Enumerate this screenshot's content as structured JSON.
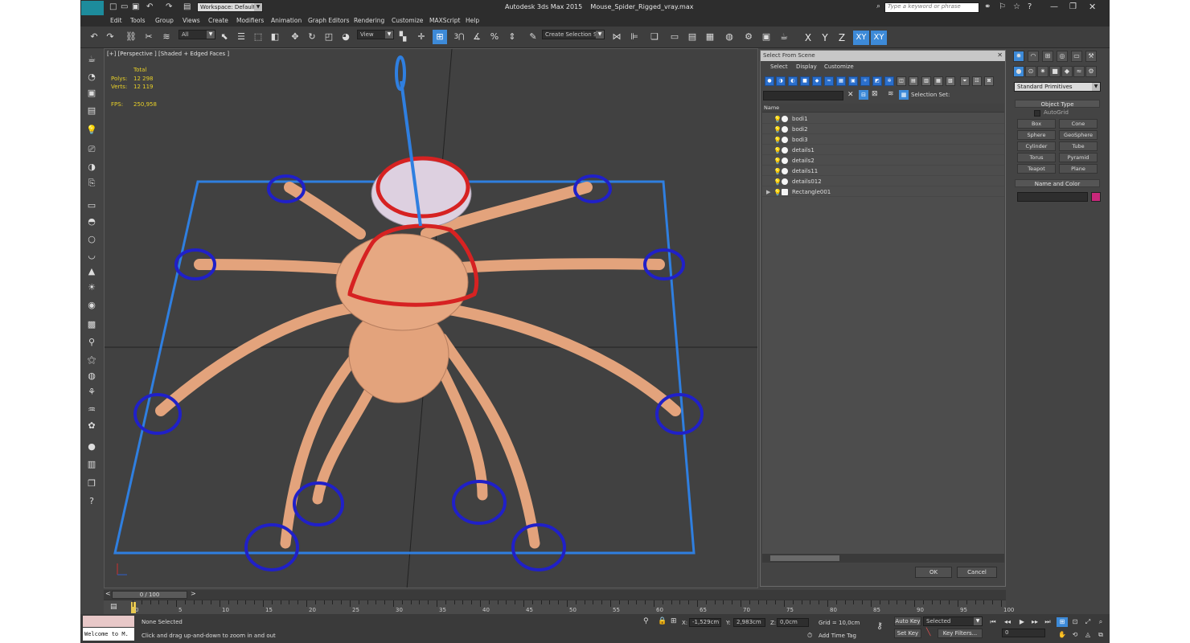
{
  "title": {
    "app": "Autodesk 3ds Max  2015",
    "file": "Mouse_Spider_Rigged_vray.max",
    "logo": "MAX",
    "workspace": "Workspace: Default",
    "search_placeholder": "Type a keyword or phrase"
  },
  "menu": [
    "Edit",
    "Tools",
    "Group",
    "Views",
    "Create",
    "Modifiers",
    "Animation",
    "Graph Editors",
    "Rendering",
    "Customize",
    "MAXScript",
    "Help"
  ],
  "toolbar": {
    "filter": "All",
    "coord": "View",
    "selection_set": "Create Selection Se",
    "snap_label": "3",
    "axes": [
      "X",
      "Y",
      "Z",
      "XY",
      "XY"
    ]
  },
  "viewport": {
    "label": "[+] [Perspective ] [Shaded + Edged Faces ]",
    "stats": {
      "total_label": "Total",
      "polys_label": "Polys:",
      "polys": "12 298",
      "verts_label": "Verts:",
      "verts": "12 119",
      "fps_label": "FPS:",
      "fps": "250,958"
    }
  },
  "scene_dialog": {
    "title": "Select From Scene",
    "menus": [
      "Select",
      "Display",
      "Customize"
    ],
    "selection_set_label": "Selection Set:",
    "column_name": "Name",
    "items": [
      "bodi1",
      "bodi2",
      "bodi3",
      "details1",
      "details2",
      "details11",
      "details012",
      "Rectangle001"
    ],
    "ok": "OK",
    "cancel": "Cancel"
  },
  "command_panel": {
    "category": "Standard Primitives",
    "object_type_title": "Object Type",
    "autogrid": "AutoGrid",
    "primitives": [
      "Box",
      "Cone",
      "Sphere",
      "GeoSphere",
      "Cylinder",
      "Tube",
      "Torus",
      "Pyramid",
      "Teapot",
      "Plane"
    ],
    "name_color_title": "Name and Color",
    "object_color": "#c8287a"
  },
  "timeline": {
    "frame": "0 / 100",
    "ticks": [
      "0",
      "5",
      "10",
      "15",
      "20",
      "25",
      "30",
      "35",
      "40",
      "45",
      "50",
      "55",
      "60",
      "65",
      "70",
      "75",
      "80",
      "85",
      "90",
      "95",
      "100"
    ]
  },
  "status": {
    "maxscript": "Welcome to M.",
    "selection": "None Selected",
    "prompt": "Click and drag up-and-down to zoom in and out",
    "x_label": "X:",
    "x": "-1,529cm",
    "y_label": "Y:",
    "y": "2,983cm",
    "z_label": "Z:",
    "z": "0,0cm",
    "grid": "Grid = 10,0cm",
    "add_time_tag": "Add Time Tag",
    "auto_key": "Auto Key",
    "set_key": "Set Key",
    "selected": "Selected",
    "key_filters": "Key Filters...",
    "frame_value": "0"
  }
}
